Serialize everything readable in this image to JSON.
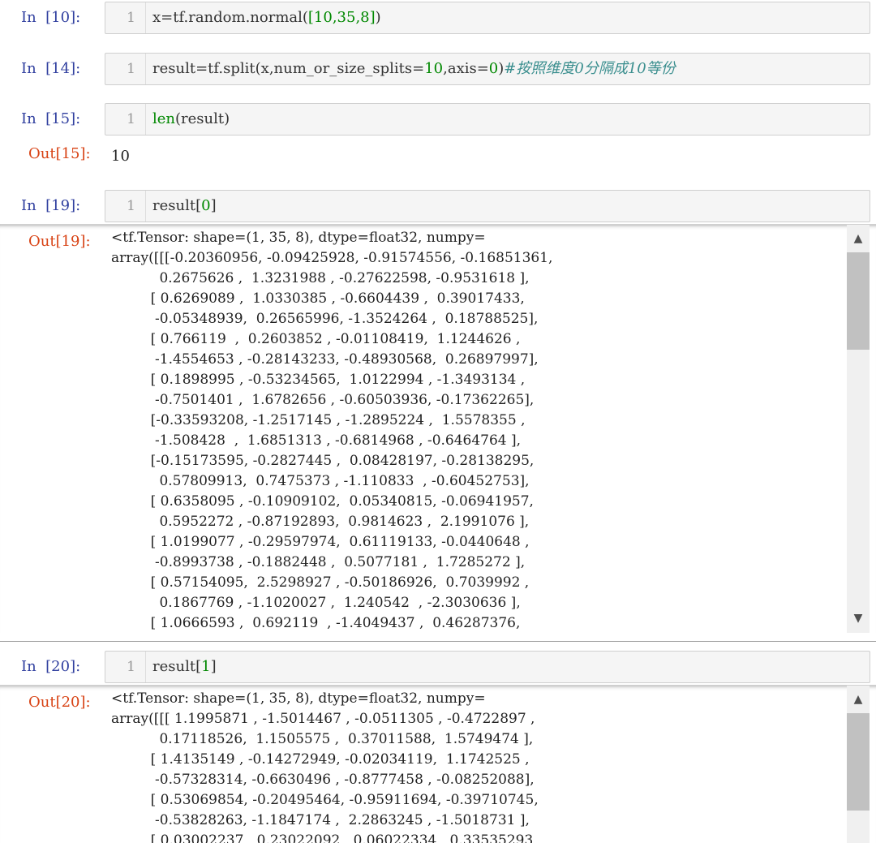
{
  "cells": [
    {
      "prompt": "In  [10]:",
      "line": "1",
      "code": {
        "a": "x=tf.random.normal(",
        "b": "[10,35,8]",
        "c": ")"
      }
    },
    {
      "prompt": "In  [14]:",
      "line": "1",
      "code": {
        "a": "result=tf.split(x,num_or_size_splits=",
        "b": "10",
        "c": ",axis=",
        "d": "0",
        "e": ")",
        "comment": "#按照维度0分隔成10等份"
      }
    },
    {
      "prompt": "In  [15]:",
      "line": "1",
      "code": {
        "fn": "len",
        "rest": "(result)"
      },
      "out_prompt": "Out[15]:",
      "out_value": "10"
    },
    {
      "prompt": "In  [19]:",
      "line": "1",
      "code": {
        "a": "result[",
        "b": "0",
        "c": "]"
      },
      "out_prompt": "Out[19]:",
      "out_lines": [
        "<tf.Tensor: shape=(1, 35, 8), dtype=float32, numpy=",
        "array([[[-0.20360956, -0.09425928, -0.91574556, -0.16851361,",
        "           0.2675626 ,  1.3231988 , -0.27622598, -0.9531618 ],",
        "         [ 0.6269089 ,  1.0330385 , -0.6604439 ,  0.39017433,",
        "          -0.05348939,  0.26565996, -1.3524264 ,  0.18788525],",
        "         [ 0.766119  ,  0.2603852 , -0.01108419,  1.1244626 ,",
        "          -1.4554653 , -0.28143233, -0.48930568,  0.26897997],",
        "         [ 0.1898995 , -0.53234565,  1.0122994 , -1.3493134 ,",
        "          -0.7501401 ,  1.6782656 , -0.60503936, -0.17362265],",
        "         [-0.33593208, -1.2517145 , -1.2895224 ,  1.5578355 ,",
        "          -1.508428  ,  1.6851313 , -0.6814968 , -0.6464764 ],",
        "         [-0.15173595, -0.2827445 ,  0.08428197, -0.28138295,",
        "           0.57809913,  0.7475373 , -1.110833  , -0.60452753],",
        "         [ 0.6358095 , -0.10909102,  0.05340815, -0.06941957,",
        "           0.5952272 , -0.87192893,  0.9814623 ,  2.1991076 ],",
        "         [ 1.0199077 , -0.29597974,  0.61119133, -0.0440648 ,",
        "          -0.8993738 , -0.1882448 ,  0.5077181 ,  1.7285272 ],",
        "         [ 0.57154095,  2.5298927 , -0.50186926,  0.7039992 ,",
        "           0.1867769 , -1.1020027 ,  1.240542  , -2.3030636 ],",
        "         [ 1.0666593 ,  0.692119  , -1.4049437 ,  0.46287376,"
      ]
    },
    {
      "prompt": "In  [20]:",
      "line": "1",
      "code": {
        "a": "result[",
        "b": "1",
        "c": "]"
      },
      "out_prompt": "Out[20]:",
      "out_lines": [
        "<tf.Tensor: shape=(1, 35, 8), dtype=float32, numpy=",
        "array([[[ 1.1995871 , -1.5014467 , -0.0511305 , -0.4722897 ,",
        "           0.17118526,  1.1505575 ,  0.37011588,  1.5749474 ],",
        "         [ 1.4135149 , -0.14272949, -0.02034119,  1.1742525 ,",
        "          -0.57328314, -0.6630496 , -0.8777458 , -0.08252088],",
        "         [ 0.53069854, -0.20495464, -0.95911694, -0.39710745,",
        "          -0.53828263, -1.1847174 ,  2.2863245 , -1.5018731 ],",
        "         [ 0.03002237,  0.23022092,  0.06022334,  0.33535293,"
      ]
    }
  ],
  "scrollbar": {
    "up_icon": "▲",
    "down_icon": "▼"
  },
  "colors": {
    "in_prompt": "#303f9f",
    "out_prompt": "#d84315",
    "string_green": "#008800",
    "comment": "#3a8e8e"
  }
}
